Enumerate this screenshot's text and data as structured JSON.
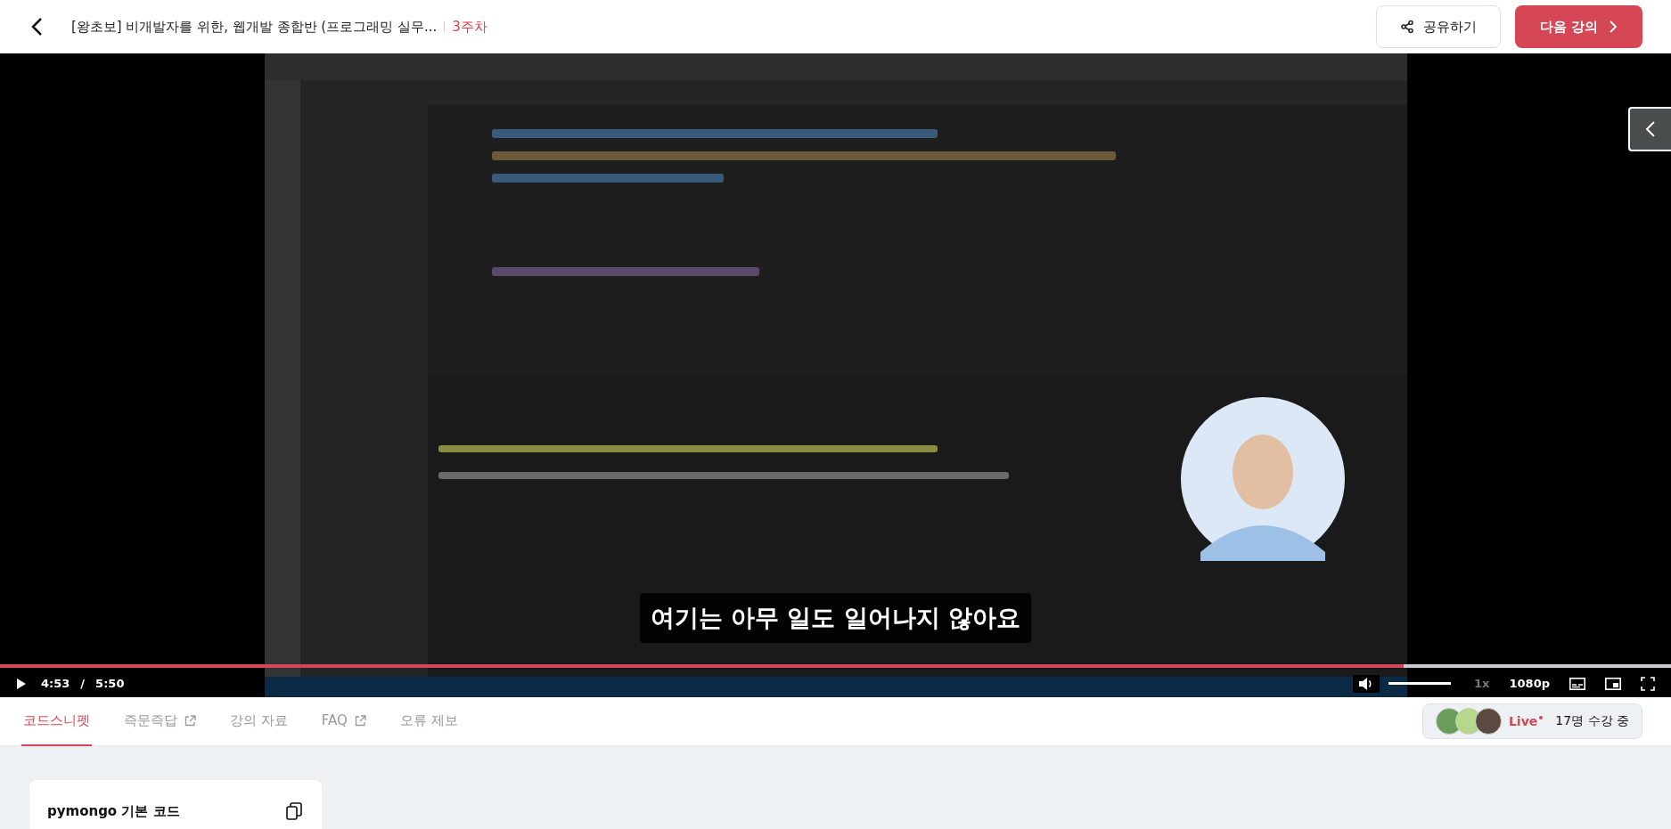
{
  "header": {
    "title": "[왕초보] 비개발자를 위한, 웹개발 종합반 (프로그래밍 실무...",
    "week": "3주차",
    "share_button": "공유하기",
    "next_button": "다음 강의"
  },
  "player": {
    "subtitle": "여기는 아무 일도 일어나지 않아요",
    "progress": {
      "level": 0.84
    },
    "current_time": "4:53",
    "separator": "/",
    "duration": "5:50",
    "volume": {
      "level": 1
    },
    "speed": "1x",
    "quality": "1080p"
  },
  "tabs": [
    {
      "label": "코드스니펫",
      "selected": true,
      "external": false
    },
    {
      "label": "즉문즉답",
      "selected": false,
      "external": true
    },
    {
      "label": "강의 자료",
      "selected": false,
      "external": false
    },
    {
      "label": "FAQ",
      "selected": false,
      "external": true
    },
    {
      "label": "오류 제보",
      "selected": false,
      "external": false
    }
  ],
  "live": {
    "label": "Live",
    "count": "17명 수강 중"
  },
  "snippet": {
    "title": "pymongo 기본 코드"
  }
}
